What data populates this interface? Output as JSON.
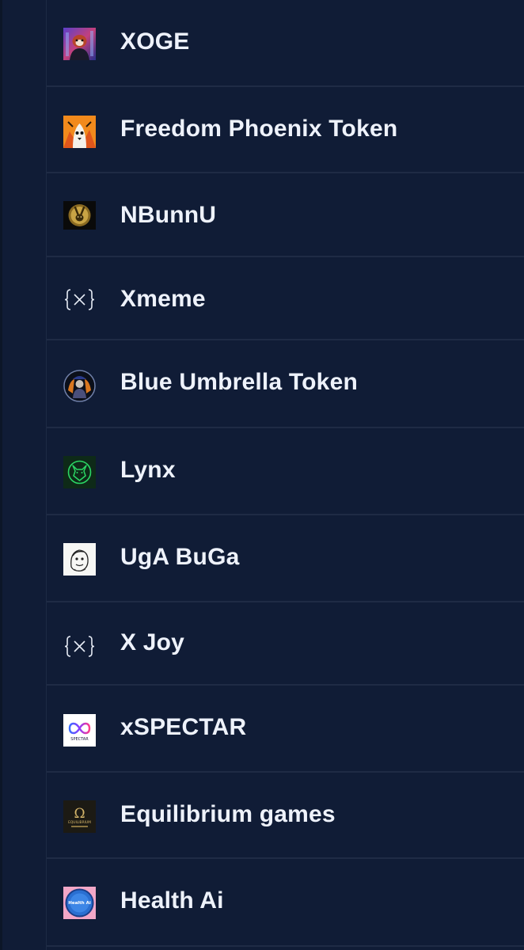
{
  "tokens": [
    {
      "name": "XOGE",
      "icon": "red-panda-avatar-icon"
    },
    {
      "name": "Freedom Phoenix Token",
      "icon": "phoenix-bird-icon"
    },
    {
      "name": "NBunnU",
      "icon": "gold-bunny-emblem-icon"
    },
    {
      "name": "Xmeme",
      "icon": "curly-brace-x-icon"
    },
    {
      "name": "Blue Umbrella Token",
      "icon": "umbrella-figure-badge-icon"
    },
    {
      "name": "Lynx",
      "icon": "lynx-head-icon"
    },
    {
      "name": "UgA BuGa",
      "icon": "sketch-face-icon"
    },
    {
      "name": "X Joy",
      "icon": "curly-brace-x-icon"
    },
    {
      "name": "xSPECTAR",
      "icon": "infinity-spectar-icon"
    },
    {
      "name": "Equilibrium games",
      "icon": "omega-equilibrium-icon"
    },
    {
      "name": "Health Ai",
      "icon": "health-ai-badge-icon"
    }
  ],
  "logo_texts": {
    "xspectar": "SPECTAR",
    "equilibrium": "EQUILIBRIUM",
    "health": "Health Ai"
  }
}
